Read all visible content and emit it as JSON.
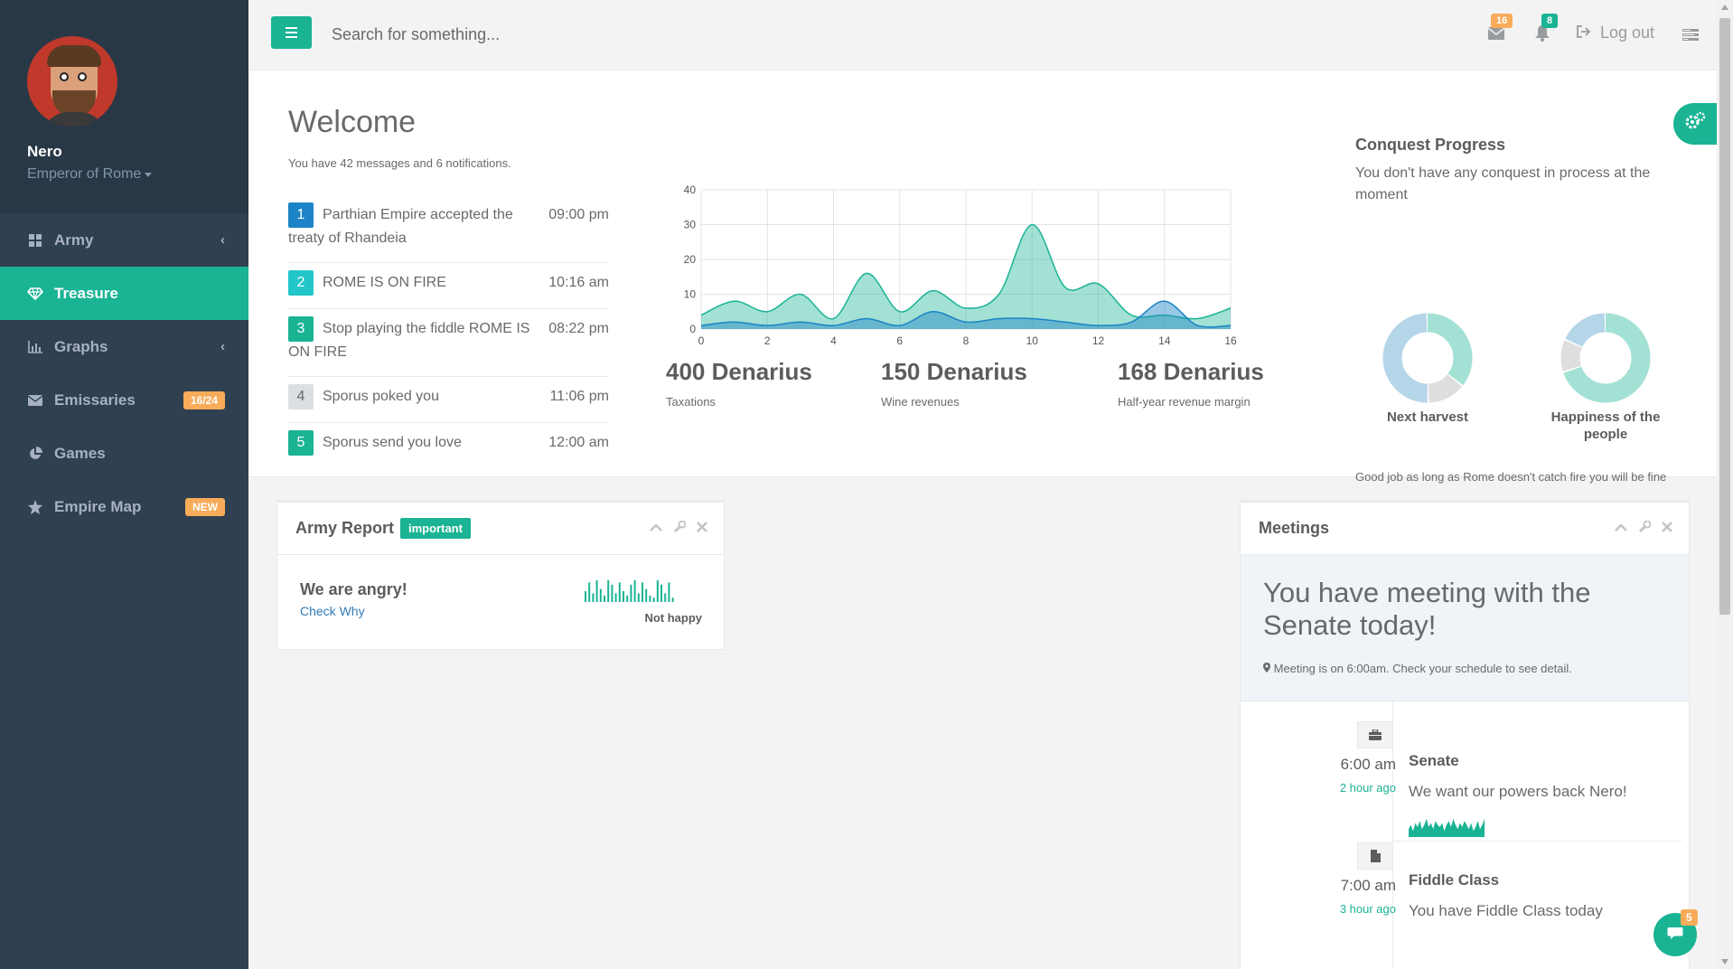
{
  "user": {
    "name": "Nero",
    "role": "Emperor of Rome"
  },
  "nav": [
    {
      "label": "Army",
      "icon": "grid-icon",
      "chevron": "‹"
    },
    {
      "label": "Treasure",
      "icon": "diamond-icon",
      "active": true
    },
    {
      "label": "Graphs",
      "icon": "bar-chart-icon",
      "chevron": "‹"
    },
    {
      "label": "Emissaries",
      "icon": "envelope-icon",
      "badge": "16/24"
    },
    {
      "label": "Games",
      "icon": "pie-chart-icon"
    },
    {
      "label": "Empire Map",
      "icon": "star-icon",
      "badge": "NEW"
    }
  ],
  "topbar": {
    "search_placeholder": "Search for something...",
    "mail_badge": "16",
    "bell_badge": "8",
    "logout": "Log out"
  },
  "welcome": {
    "title": "Welcome",
    "subtitle": "You have 42 messages and 6 notifications.",
    "messages": [
      {
        "num": "1",
        "text": "Parthian Empire accepted the treaty of Rhandeia",
        "time": "09:00 pm",
        "color": "#1c84c6"
      },
      {
        "num": "2",
        "text": "ROME IS ON FIRE",
        "time": "10:16 am",
        "color": "#23c6c8"
      },
      {
        "num": "3",
        "text": "Stop playing the fiddle ROME IS ON FIRE",
        "time": "08:22 pm",
        "color": "#1ab394"
      },
      {
        "num": "4",
        "text": "Sporus poked you",
        "time": "11:06 pm",
        "color": "#c4c8cc"
      },
      {
        "num": "5",
        "text": "Sporus send you love",
        "time": "12:00 am",
        "color": "#1ab394"
      }
    ]
  },
  "chart_data": {
    "type": "area",
    "xlim": [
      0,
      16
    ],
    "ylim": [
      0,
      40
    ],
    "xticks": [
      "0",
      "2",
      "4",
      "6",
      "8",
      "10",
      "12",
      "14",
      "16"
    ],
    "yticks": [
      "0",
      "10",
      "20",
      "30",
      "40"
    ],
    "grid": true,
    "series": [
      {
        "color": "#1ab394",
        "points": [
          [
            0,
            4
          ],
          [
            1,
            8
          ],
          [
            2,
            5
          ],
          [
            3,
            10
          ],
          [
            4,
            3
          ],
          [
            5,
            16
          ],
          [
            6,
            5
          ],
          [
            7,
            11
          ],
          [
            8,
            6
          ],
          [
            9,
            10
          ],
          [
            10,
            30
          ],
          [
            11,
            12
          ],
          [
            12,
            13
          ],
          [
            13,
            4
          ],
          [
            14,
            4
          ],
          [
            15,
            3
          ],
          [
            16,
            6
          ]
        ]
      },
      {
        "color": "#1c84c6",
        "points": [
          [
            0,
            1
          ],
          [
            1,
            2
          ],
          [
            2,
            1
          ],
          [
            3,
            2
          ],
          [
            4,
            1
          ],
          [
            5,
            3
          ],
          [
            6,
            1
          ],
          [
            7,
            5
          ],
          [
            8,
            2
          ],
          [
            9,
            3
          ],
          [
            10,
            3
          ],
          [
            11,
            2
          ],
          [
            12,
            1
          ],
          [
            13,
            2
          ],
          [
            14,
            8
          ],
          [
            15,
            1
          ],
          [
            16,
            1
          ]
        ]
      }
    ]
  },
  "stats": [
    {
      "value": "400 Denarius",
      "label": "Taxations"
    },
    {
      "value": "150 Denarius",
      "label": "Wine revenues"
    },
    {
      "value": "168 Denarius",
      "label": "Half-year revenue margin"
    }
  ],
  "conquest": {
    "title": "Conquest Progress",
    "subtitle": "You don't have any conquest in process at the moment",
    "donuts": [
      {
        "label": "Next harvest",
        "segments": [
          {
            "value": 36,
            "color": "#a3e1d4"
          },
          {
            "value": 14,
            "color": "#dedede"
          },
          {
            "value": 50,
            "color": "#b5d5e8"
          }
        ]
      },
      {
        "label": "Happiness of the people",
        "segments": [
          {
            "value": 70,
            "color": "#a3e1d4"
          },
          {
            "value": 12,
            "color": "#dedede"
          },
          {
            "value": 18,
            "color": "#b5d5e8"
          }
        ]
      }
    ],
    "note": "Good job as long as Rome doesn't catch fire you will be fine"
  },
  "army_report": {
    "title": "Army Report",
    "label": "important",
    "headline": "We are angry!",
    "link": "Check Why",
    "spark_label": "Not happy",
    "spark_values": [
      5,
      9,
      4,
      10,
      6,
      3,
      10,
      8,
      4,
      9,
      5,
      3,
      8,
      10,
      4,
      9,
      6,
      3,
      2,
      10,
      8,
      4,
      9,
      2
    ]
  },
  "meetings": {
    "title": "Meetings",
    "hero_title": "You have meeting with the Senate today!",
    "hero_sub": "Meeting is on 6:00am. Check your schedule to see detail.",
    "items": [
      {
        "time": "6:00 am",
        "ago": "2 hour ago",
        "title": "Senate",
        "desc": "We want our powers back Nero!",
        "icon": "briefcase-icon"
      },
      {
        "time": "7:00 am",
        "ago": "3 hour ago",
        "title": "Fiddle Class",
        "desc": "You have Fiddle Class today",
        "icon": "file-icon"
      }
    ],
    "spark_values": [
      4,
      6,
      3,
      7,
      5,
      8,
      4,
      6,
      9,
      5,
      7,
      4,
      8,
      6,
      5,
      7,
      3,
      6,
      8,
      5,
      9,
      6,
      4,
      7,
      5,
      8,
      6,
      4,
      7,
      3,
      5,
      8,
      4,
      6,
      9
    ]
  },
  "chat_badge": "5"
}
